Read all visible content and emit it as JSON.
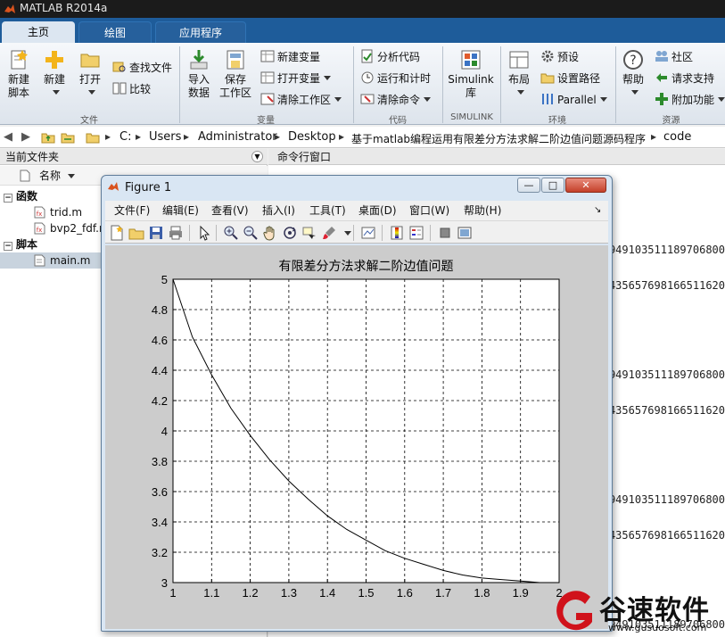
{
  "app": {
    "title": "MATLAB R2014a"
  },
  "tabs": [
    {
      "label": "主页",
      "active": true
    },
    {
      "label": "绘图",
      "active": false
    },
    {
      "label": "应用程序",
      "active": false
    }
  ],
  "ribbon": {
    "file": {
      "new_script": "新建\n脚本",
      "new": "新建",
      "open": "打开",
      "find_files": "查找文件",
      "compare": "比较",
      "group": "文件"
    },
    "variable": {
      "import": "导入\n数据",
      "save": "保存\n工作区",
      "new_var": "新建变量",
      "open_var": "打开变量",
      "clear_ws": "清除工作区",
      "group": "变量"
    },
    "code": {
      "analyze": "分析代码",
      "run_time": "运行和计时",
      "clear_cmd": "清除命令",
      "group": "代码"
    },
    "simulink": {
      "label": "Simulink\n库",
      "group": "SIMULINK"
    },
    "env": {
      "layout": "布局",
      "prefs": "预设",
      "set_path": "设置路径",
      "parallel": "Parallel",
      "group": "环境"
    },
    "resources": {
      "help": "帮助",
      "community": "社区",
      "support": "请求支持",
      "addons": "附加功能",
      "group": "资源"
    }
  },
  "address": {
    "crumbs": [
      "C:",
      "Users",
      "Administrator",
      "Desktop",
      "基于matlab编程运用有限差分方法求解二阶边值问题源码程序",
      "code"
    ]
  },
  "left_panel": {
    "title": "当前文件夹",
    "col_name": "名称",
    "groups": [
      {
        "label": "函数",
        "items": [
          "trid.m",
          "bvp2_fdf.m"
        ]
      },
      {
        "label": "脚本",
        "items": [
          "main.m"
        ]
      }
    ]
  },
  "cmd_panel": {
    "title": "命令行窗口",
    "lines": [
      "2949103511189706800",
      "3435657698166511620",
      "2949103511189706800",
      "3435657698166511620",
      "2949103511189706800",
      "3435657698166511620",
      "2949103511189706800"
    ]
  },
  "figure": {
    "title": "Figure 1",
    "menu": [
      "文件(F)",
      "编辑(E)",
      "查看(V)",
      "插入(I)",
      "工具(T)",
      "桌面(D)",
      "窗口(W)",
      "帮助(H)"
    ]
  },
  "chart_data": {
    "type": "line",
    "title": "有限差分方法求解二阶边值问题",
    "xlabel": "",
    "ylabel": "",
    "xlim": [
      1,
      2
    ],
    "ylim": [
      3,
      5
    ],
    "grid": true,
    "x_ticks": [
      1,
      1.1,
      1.2,
      1.3,
      1.4,
      1.5,
      1.6,
      1.7,
      1.8,
      1.9,
      2
    ],
    "y_ticks": [
      3,
      3.2,
      3.4,
      3.6,
      3.8,
      4,
      4.2,
      4.4,
      4.6,
      4.8,
      5
    ],
    "series": [
      {
        "x": [
          1,
          1.05,
          1.1,
          1.15,
          1.2,
          1.25,
          1.3,
          1.35,
          1.4,
          1.45,
          1.5,
          1.55,
          1.6,
          1.65,
          1.7,
          1.75,
          1.8,
          1.85,
          1.9,
          1.95,
          2
        ],
        "y": [
          5,
          4.62,
          4.37,
          4.15,
          3.97,
          3.81,
          3.67,
          3.55,
          3.44,
          3.35,
          3.28,
          3.21,
          3.16,
          3.12,
          3.08,
          3.05,
          3.03,
          3.02,
          3.01,
          3.0,
          3
        ]
      }
    ]
  },
  "watermark": {
    "text": "谷速软件",
    "url": "www.gusuosoft.com"
  }
}
